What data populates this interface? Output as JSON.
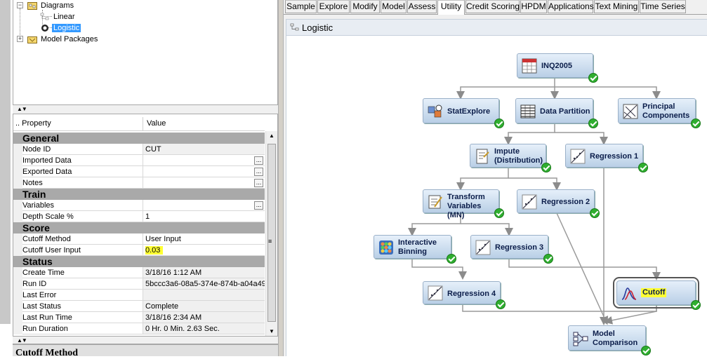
{
  "tree": {
    "diagrams_label": "Diagrams",
    "linear_label": "Linear",
    "logistic_label": "Logistic",
    "model_packages_label": "Model Packages"
  },
  "properties": {
    "col_property": ".. Property",
    "col_value": "Value",
    "sections": {
      "general": "General",
      "train": "Train",
      "score": "Score",
      "status": "Status"
    },
    "rows": {
      "node_id": {
        "name": "Node ID",
        "value": "CUT"
      },
      "imported_data": {
        "name": "Imported Data",
        "value": ""
      },
      "exported_data": {
        "name": "Exported Data",
        "value": ""
      },
      "notes": {
        "name": "Notes",
        "value": ""
      },
      "variables": {
        "name": "Variables",
        "value": ""
      },
      "depth_scale": {
        "name": "Depth Scale %",
        "value": "1"
      },
      "cutoff_method": {
        "name": "Cutoff Method",
        "value": "User Input"
      },
      "cutoff_user_input": {
        "name": "Cutoff User Input",
        "value": "0.03"
      },
      "create_time": {
        "name": "Create Time",
        "value": "3/18/16 1:12 AM"
      },
      "run_id": {
        "name": "Run ID",
        "value": "5bccc3a6-08a5-374e-874b-a04a49"
      },
      "last_error": {
        "name": "Last Error",
        "value": ""
      },
      "last_status": {
        "name": "Last Status",
        "value": "Complete"
      },
      "last_run_time": {
        "name": "Last Run Time",
        "value": "3/18/16 2:34 AM"
      },
      "run_duration": {
        "name": "Run Duration",
        "value": "0 Hr. 0 Min. 2.63 Sec."
      }
    },
    "ellipsis_label": "...",
    "description_title": "Cutoff Method"
  },
  "tabs": [
    "Sample",
    "Explore",
    "Modify",
    "Model",
    "Assess",
    "Utility",
    "Credit Scoring",
    "HPDM",
    "Applications",
    "Text Mining",
    "Time Series"
  ],
  "active_tab": "Utility",
  "diagram": {
    "title": "Logistic",
    "nodes": {
      "inq2005": "INQ2005",
      "statexplore": "StatExplore",
      "data_partition": "Data Partition",
      "principal_components": "Principal\nComponents",
      "impute": "Impute\n(Distribution)",
      "regression1": "Regression 1",
      "transform": "Transform\nVariables (MN)",
      "regression2": "Regression 2",
      "interactive_binning": "Interactive\nBinning",
      "regression3": "Regression 3",
      "regression4": "Regression 4",
      "cutoff": "Cutoff",
      "model_comparison": "Model\nComparison"
    }
  },
  "colors": {
    "node_fill_top": "#e6f0fa",
    "node_fill_bottom": "#b9cfe6",
    "check_green": "#2fae2f",
    "highlight_yellow": "#ffff33",
    "selection_blue": "#3399ff"
  }
}
